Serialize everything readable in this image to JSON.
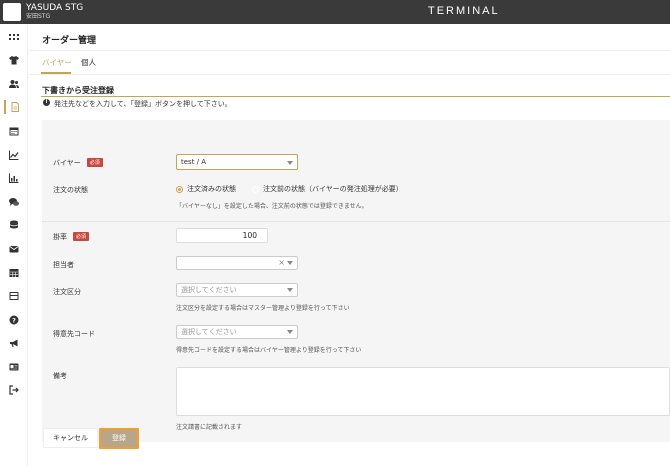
{
  "header": {
    "company_name": "YASUDA STG",
    "company_sub": "安田STG",
    "brand": "TERMINAL"
  },
  "sidebar": {
    "items": [
      {
        "icon": "apps-grid-icon"
      },
      {
        "icon": "tshirt-icon"
      },
      {
        "icon": "users-icon"
      },
      {
        "icon": "document-icon",
        "active": true
      },
      {
        "icon": "calendar-icon"
      },
      {
        "icon": "line-chart-icon"
      },
      {
        "icon": "bar-chart-icon"
      },
      {
        "icon": "chat-icon"
      },
      {
        "icon": "database-icon"
      },
      {
        "icon": "mail-icon"
      },
      {
        "icon": "table-icon"
      },
      {
        "icon": "archive-icon"
      },
      {
        "icon": "help-icon"
      },
      {
        "icon": "megaphone-icon"
      },
      {
        "icon": "id-card-icon"
      },
      {
        "icon": "logout-icon"
      }
    ]
  },
  "page": {
    "title": "オーダー管理",
    "tabs": [
      {
        "label": "バイヤー",
        "active": true
      },
      {
        "label": "個人"
      }
    ],
    "section_title": "下書きから受注登録",
    "info_text": "発注先などを入力して、「登録」ボタンを押して下さい。"
  },
  "form": {
    "required_badge": "必須",
    "buyer": {
      "label": "バイヤー",
      "value": "test / A"
    },
    "order_status": {
      "label": "注文の状態",
      "option1": "注文済みの状態",
      "option2": "注文前の状態（バイヤーの発注処理が必要）",
      "hint": "「バイヤーなし」を設定した場合、注文前の状態では登録できません。"
    },
    "rate": {
      "label": "掛率",
      "value": "100"
    },
    "staff": {
      "label": "担当者",
      "clear": "×"
    },
    "order_type": {
      "label": "注文区分",
      "placeholder": "選択してください",
      "hint": "注文区分を設定する場合はマスター管理より登録を行って下さい"
    },
    "customer_code": {
      "label": "得意先コード",
      "placeholder": "選択してください",
      "hint": "得意先コードを設定する場合はバイヤー管理より登録を行って下さい"
    },
    "notes": {
      "label": "備考",
      "hint": "注文請書に記載されます"
    }
  },
  "actions": {
    "cancel": "キャンセル",
    "submit": "登録"
  },
  "colors": {
    "accent": "#c8a25a",
    "topbar": "#3a3a3a",
    "required": "#c9473d",
    "submit_border": "#f0a030"
  }
}
